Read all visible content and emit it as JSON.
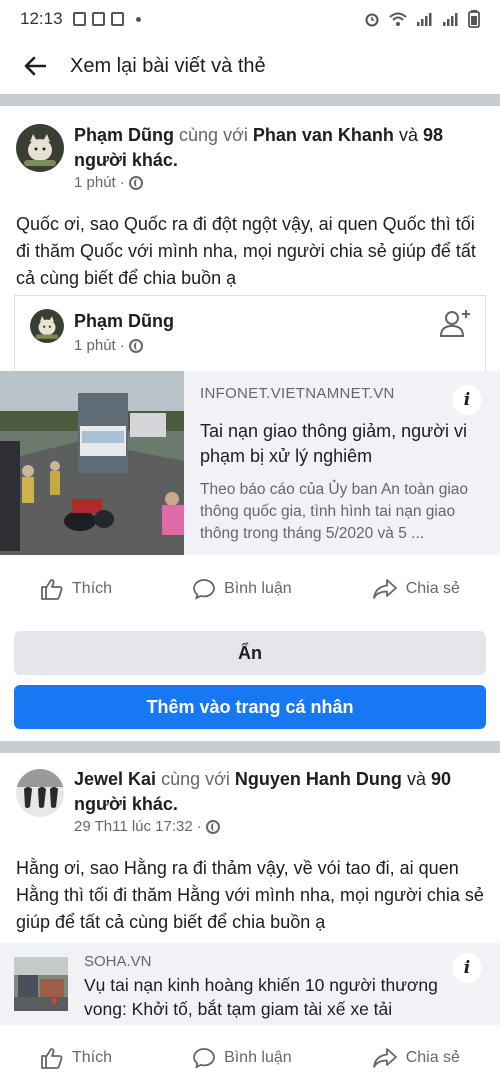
{
  "status_bar": {
    "time": "12:13"
  },
  "header": {
    "title": "Xem lại bài viết và thẻ"
  },
  "post1": {
    "author": "Phạm Dũng",
    "with_word": "cùng với",
    "tagged": "Phan van Khanh",
    "and_word": "và",
    "others_count": "98",
    "others_label": "người khác.",
    "time": "1 phút",
    "text": "Quốc ơi, sao Quốc ra đi đột ngột vậy, ai quen Quốc thì tối đi thăm Quốc  với mình nha, mọi người chia sẻ giúp để tất cả cùng biết để chia buồn ạ",
    "shared": {
      "author": "Phạm Dũng",
      "time": "1 phút",
      "link": {
        "domain": "INFONET.VIETNAMNET.VN",
        "title": "Tai nạn giao thông giảm, người vi phạm bị xử lý nghiêm",
        "description": "Theo báo cáo của Ủy ban An toàn giao thông quốc gia, tình hình tai nạn giao thông trong tháng 5/2020 và 5 ..."
      }
    },
    "actions": {
      "like": "Thích",
      "comment": "Bình luận",
      "share": "Chia sẻ"
    },
    "hide_label": "Ẩn",
    "add_label": "Thêm vào trang cá nhân"
  },
  "post2": {
    "author": "Jewel Kai",
    "with_word": "cùng với",
    "tagged": "Nguyen Hanh Dung",
    "and_word": "và",
    "others_count": "90",
    "others_label": "người khác.",
    "time": "29 Th11 lúc 17:32",
    "text": "Hằng ơi, sao Hằng ra đi thảm vậy, về vói tao đi, ai quen Hằng thì tối đi thăm Hằng với mình nha, mọi người chia sẻ giúp để tất cả cùng biết để chia buồn ạ",
    "link": {
      "domain": "SOHA.VN",
      "title": "Vụ tai nạn kinh hoàng khiến 10 người thương vong: Khởi tố, bắt tạm giam tài xế xe tải"
    },
    "actions": {
      "like": "Thích",
      "comment": "Bình luận",
      "share": "Chia sẻ"
    }
  },
  "colors": {
    "primary": "#1877f2",
    "separator": "#c9ccd1",
    "secondary_text": "#65676b"
  },
  "icons": [
    "back-arrow-icon",
    "globe-icon",
    "add-friend-icon",
    "info-icon",
    "like-icon",
    "comment-icon",
    "share-icon"
  ]
}
